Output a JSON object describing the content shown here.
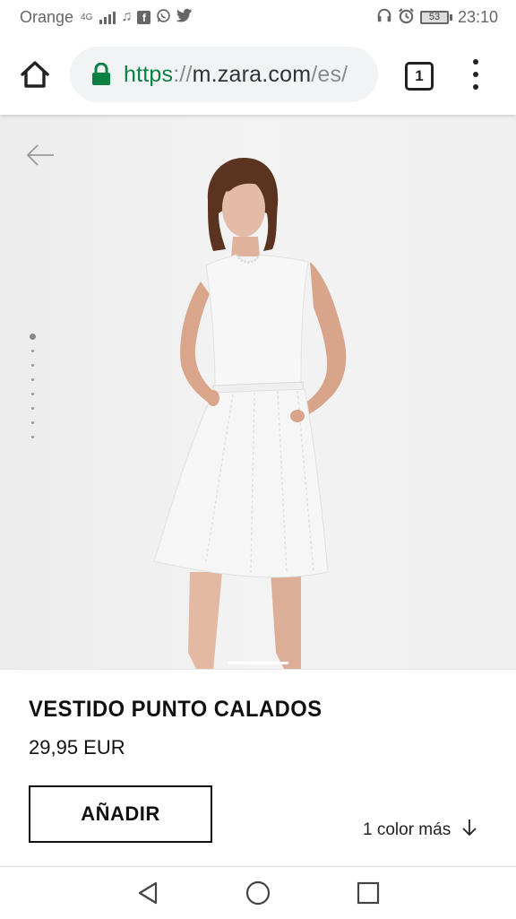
{
  "status_bar": {
    "carrier": "Orange",
    "network_type": "4G",
    "icons": [
      "network-icon",
      "signal-icon",
      "music-icon",
      "facebook-icon",
      "whatsapp-icon",
      "twitter-icon",
      "headphones-icon",
      "alarm-icon",
      "battery-icon"
    ],
    "facebook_glyph": "f",
    "battery_level": "53",
    "time": "23:10"
  },
  "browser": {
    "url_scheme": "https",
    "url_separator": "://",
    "url_host": "m.zara.com",
    "url_path": "/es/",
    "tab_count": "1",
    "icons": [
      "home-icon",
      "lock-icon",
      "tabs-icon",
      "more-vert-icon"
    ]
  },
  "gallery": {
    "image_count": 8,
    "active_index": 0,
    "icons": [
      "back-arrow-icon"
    ]
  },
  "product": {
    "name": "VESTIDO PUNTO CALADOS",
    "price": "29,95 EUR",
    "add_label": "AÑADIR",
    "more_colors_label": "1 color más",
    "icons": [
      "arrow-down-icon"
    ]
  },
  "nav_bar": {
    "icons": [
      "back-triangle-icon",
      "home-circle-icon",
      "recents-square-icon"
    ]
  },
  "colors": {
    "url_scheme": "#0b8043",
    "lock": "#0b8043",
    "text": "#111111",
    "image_bg": "#efefef",
    "dress": "#f7f7f7"
  }
}
